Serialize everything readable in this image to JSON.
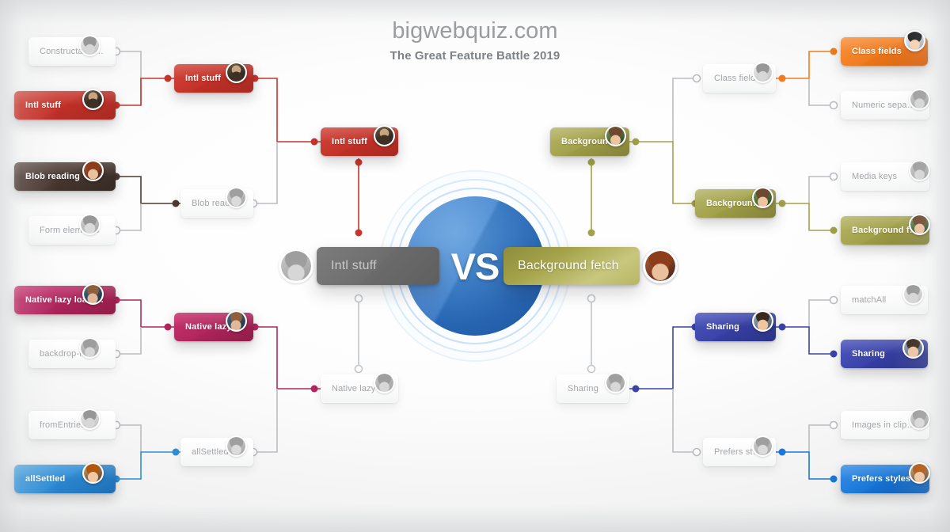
{
  "header": {
    "site_title": "bigwebquiz.com",
    "subtitle": "The Great Feature Battle 2019"
  },
  "center": {
    "vs_label": "VS",
    "left_finalist": "Intl stuff",
    "right_finalist": "Background fetch"
  },
  "colors": {
    "intl_stuff": "#c8352c",
    "blob_reading": "#4a3a33",
    "native_lazy_loading": "#b3275e",
    "all_settled": "#2f8ed6",
    "class_fields": "#f07c1e",
    "background_fetch": "#a3a24a",
    "sharing": "#3b44a8",
    "prefers_styles": "#1a78d8",
    "eliminated": "#a2a5a9",
    "final_loser": "#6e6e6e",
    "vs_badge": "#3579c8"
  },
  "left_bracket": {
    "round1": [
      {
        "label": "Constructable style ...",
        "state": "eliminated",
        "avatar": "f4"
      },
      {
        "label": "Intl stuff",
        "state": "winner",
        "avatar": "f1"
      },
      {
        "label": "Blob reading",
        "state": "winner",
        "avatar": "f8"
      },
      {
        "label": "Form elements",
        "state": "eliminated",
        "avatar": "f3"
      },
      {
        "label": "Native lazy loading",
        "state": "winner",
        "avatar": "f2"
      },
      {
        "label": "backdrop-filter",
        "state": "eliminated",
        "avatar": "f9"
      },
      {
        "label": "fromEntries",
        "state": "eliminated",
        "avatar": "f4"
      },
      {
        "label": "allSettled",
        "state": "winner",
        "avatar": "f5"
      }
    ],
    "round2": [
      {
        "label": "Intl stuff",
        "state": "winner",
        "avatar": "f1"
      },
      {
        "label": "Blob reading",
        "state": "eliminated",
        "avatar": "f10"
      },
      {
        "label": "Native lazy loading",
        "state": "winner",
        "avatar": "f2"
      },
      {
        "label": "allSettled",
        "state": "eliminated",
        "avatar": "f10"
      }
    ],
    "round3": [
      {
        "label": "Intl stuff",
        "state": "winner",
        "avatar": "f1"
      },
      {
        "label": "Native lazy loading",
        "state": "eliminated",
        "avatar": "f9"
      }
    ]
  },
  "right_bracket": {
    "round1": [
      {
        "label": "Class fields",
        "state": "winner",
        "avatar": "f7"
      },
      {
        "label": "Numeric separators",
        "state": "eliminated",
        "avatar": "f9"
      },
      {
        "label": "Media keys",
        "state": "eliminated",
        "avatar": "f9"
      },
      {
        "label": "Background fetch",
        "state": "winner",
        "avatar": "f6"
      },
      {
        "label": "matchAll",
        "state": "eliminated",
        "avatar": "f4"
      },
      {
        "label": "Sharing",
        "state": "winner",
        "avatar": "f3"
      },
      {
        "label": "Images in clipboard",
        "state": "eliminated",
        "avatar": "f10"
      },
      {
        "label": "Prefers styles",
        "state": "winner",
        "avatar": "f5"
      }
    ],
    "round2": [
      {
        "label": "Class fields",
        "state": "eliminated",
        "avatar": "f4"
      },
      {
        "label": "Background fetch",
        "state": "winner",
        "avatar": "f6"
      },
      {
        "label": "Sharing",
        "state": "winner",
        "avatar": "f3"
      },
      {
        "label": "Prefers styles",
        "state": "eliminated",
        "avatar": "f10"
      }
    ],
    "round3": [
      {
        "label": "Background fetch",
        "state": "winner",
        "avatar": "f6"
      },
      {
        "label": "Sharing",
        "state": "eliminated",
        "avatar": "f9"
      }
    ]
  },
  "semifinal_avatars": {
    "left": "f9",
    "right": "f8"
  }
}
